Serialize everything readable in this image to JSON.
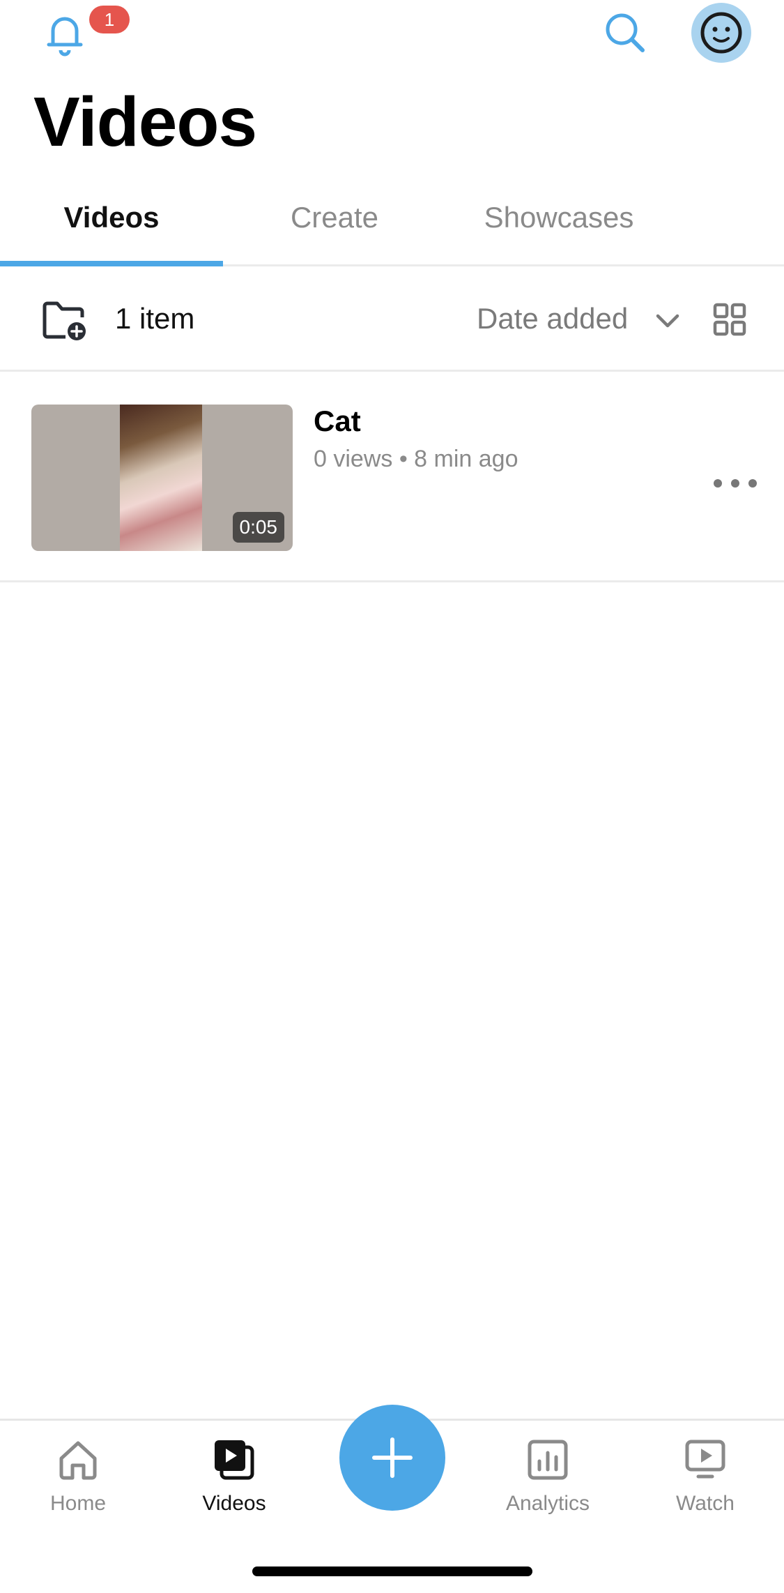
{
  "header": {
    "notification_count": "1",
    "title": "Videos"
  },
  "tabs": [
    {
      "label": "Videos",
      "active": true
    },
    {
      "label": "Create",
      "active": false
    },
    {
      "label": "Showcases",
      "active": false
    }
  ],
  "toolbar": {
    "item_count": "1 item",
    "sort_label": "Date added"
  },
  "videos": [
    {
      "title": "Cat",
      "meta": "0 views • 8 min ago",
      "duration": "0:05"
    }
  ],
  "bottom_nav": [
    {
      "label": "Home",
      "icon": "home-icon",
      "active": false
    },
    {
      "label": "Videos",
      "icon": "videos-icon",
      "active": true
    },
    {
      "label": "Analytics",
      "icon": "analytics-icon",
      "active": false
    },
    {
      "label": "Watch",
      "icon": "watch-icon",
      "active": false
    }
  ],
  "colors": {
    "accent": "#4ca7e6",
    "badge": "#e5554d",
    "muted_text": "#8a8a8a"
  }
}
